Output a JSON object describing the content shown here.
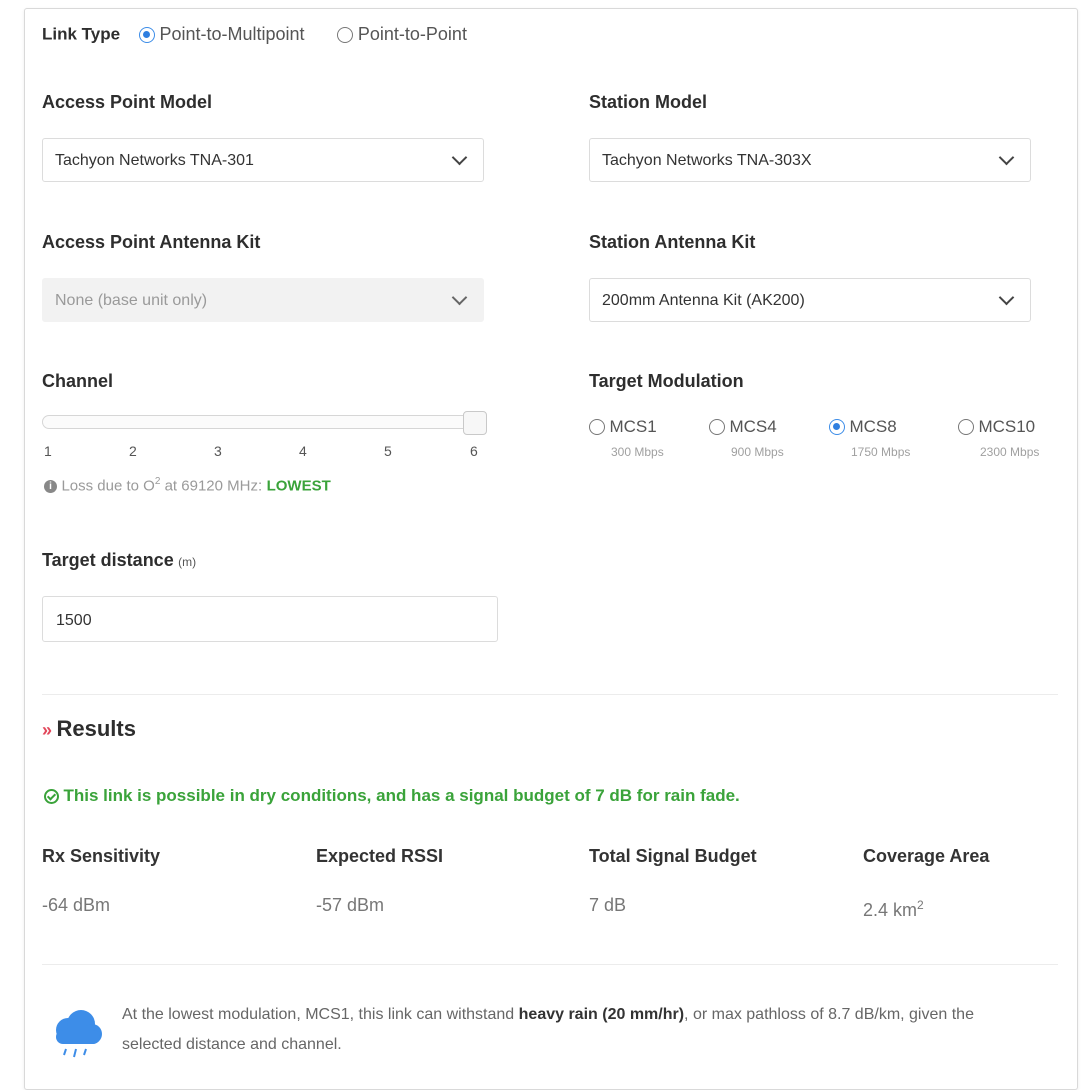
{
  "link_type": {
    "label": "Link Type",
    "options": [
      {
        "label": "Point-to-Multipoint",
        "selected": true
      },
      {
        "label": "Point-to-Point",
        "selected": false
      }
    ]
  },
  "ap_model": {
    "label": "Access Point Model",
    "value": "Tachyon Networks TNA-301"
  },
  "station_model": {
    "label": "Station Model",
    "value": "Tachyon Networks TNA-303X"
  },
  "ap_antenna": {
    "label": "Access Point Antenna Kit",
    "value": "None (base unit only)",
    "disabled": true
  },
  "station_antenna": {
    "label": "Station Antenna Kit",
    "value": "200mm Antenna Kit (AK200)"
  },
  "channel": {
    "label": "Channel",
    "ticks": [
      "1",
      "2",
      "3",
      "4",
      "5",
      "6"
    ],
    "selected": 6,
    "loss_text": "Loss due to O",
    "loss_sup": "2",
    "loss_freq": " at 69120 MHz:",
    "loss_level": "LOWEST"
  },
  "modulation": {
    "label": "Target Modulation",
    "options": [
      {
        "name": "MCS1",
        "rate": "300 Mbps",
        "selected": false
      },
      {
        "name": "MCS4",
        "rate": "900 Mbps",
        "selected": false
      },
      {
        "name": "MCS8",
        "rate": "1750 Mbps",
        "selected": true
      },
      {
        "name": "MCS10",
        "rate": "2300 Mbps",
        "selected": false
      }
    ]
  },
  "distance": {
    "label": "Target distance",
    "unit": "(m)",
    "value": "1500"
  },
  "results": {
    "heading": "Results",
    "status": "This link is possible in dry conditions, and has a signal budget of 7 dB for rain fade.",
    "stats": [
      {
        "label": "Rx Sensitivity",
        "value": "-64 dBm"
      },
      {
        "label": "Expected RSSI",
        "value": "-57 dBm"
      },
      {
        "label": "Total Signal Budget",
        "value": "7 dB"
      },
      {
        "label": "Coverage Area",
        "value": "2.4 km",
        "sup": "2"
      }
    ],
    "note_part1": "At the lowest modulation, MCS1, this link can withstand ",
    "note_bold": "heavy rain (20 mm/hr)",
    "note_part2": ", or max pathloss of 8.7 dB/km, given the selected distance and channel."
  },
  "colors": {
    "accent": "#2f7fe0",
    "success": "#3aa33a",
    "chevron": "#e2465a",
    "cloud": "#3d8de8"
  }
}
